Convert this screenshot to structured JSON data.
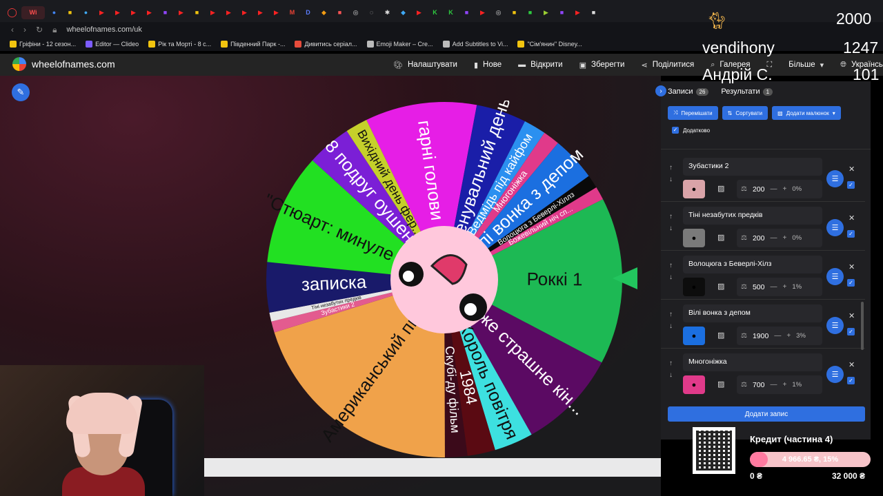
{
  "browser": {
    "active_tab_label": "Wi",
    "url": "wheelofnames.com/uk",
    "bookmarks": [
      {
        "label": "Грiфiни - 12 сезон...",
        "color": "#f1c40f"
      },
      {
        "label": "Editor — Clideo",
        "color": "#7c5cff"
      },
      {
        "label": "Рiк та Морті - 8 с...",
        "color": "#f1c40f"
      },
      {
        "label": "Південний Парк -...",
        "color": "#f1c40f"
      },
      {
        "label": "Дивитись серіал...",
        "color": "#e74c3c"
      },
      {
        "label": "Emoji Maker – Cre...",
        "color": "#bbbbbb"
      },
      {
        "label": "Add Subtitles to Vi...",
        "color": "#bbbbbb"
      },
      {
        "label": "\"Сім'янин\" Disney...",
        "color": "#f1c40f"
      }
    ]
  },
  "app": {
    "brand": "wheelofnames.com",
    "menu": [
      "Налаштувати",
      "Нове",
      "Відкрити",
      "Зберегти",
      "Поділитися",
      "Галерея",
      "",
      "Більше",
      "Українська"
    ]
  },
  "wheel": {
    "slices": [
      {
        "label": "Роккі 1",
        "color": "#1db954",
        "weight": 1
      },
      {
        "label": "Дуже страшне кін...",
        "color": "#5b0a63",
        "weight": 1
      },
      {
        "label": "Король повітря",
        "color": "#3de0e0",
        "weight": 1
      },
      {
        "label": "1984",
        "color": "#5a0a12",
        "weight": 1
      },
      {
        "label": "Скубі-ду фільм",
        "color": "#3b0a1a",
        "weight": 1
      },
      {
        "label": "Американський пир...",
        "color": "#f0a24a",
        "weight": 1
      },
      {
        "label": "Зубастики 2",
        "color": "#e35b8f",
        "weight": 1
      },
      {
        "label": "Тiнi незабутих предкiв",
        "color": "#e8e8e8",
        "weight": 1
      },
      {
        "label": "записка",
        "color": "#191a6a",
        "weight": 1
      },
      {
        "label": "\"Стюарт: минуле ж...",
        "color": "#22e022",
        "weight": 1
      },
      {
        "label": "8 подруг оушена",
        "color": "#7b1fd6",
        "weight": 1
      },
      {
        "label": "Вихідний день фер...",
        "color": "#c5d02b",
        "weight": 1
      },
      {
        "label": "гарні голови",
        "color": "#e61ee6",
        "weight": 1
      },
      {
        "label": "Тренувальний день",
        "color": "#1a1ea8",
        "weight": 1
      },
      {
        "label": "Ведмідь під кайфом",
        "color": "#2b90f0",
        "weight": 1
      },
      {
        "label": "Многоніжка",
        "color": "#e03a8a",
        "weight": 1
      },
      {
        "label": "Вiлi вонка з депом",
        "color": "#1b6fe0",
        "weight": 1
      },
      {
        "label": "Волоцюга з Беверлі-Хіллз",
        "color": "#0a0a0a",
        "weight": 1
      },
      {
        "label": "Божевільний ніч сп...",
        "color": "#e03a8a",
        "weight": 1
      }
    ]
  },
  "sidebar": {
    "tab_entries": "Записи",
    "entries_count": "26",
    "tab_results": "Результати",
    "results_count": "1",
    "shuffle": "Перемішати",
    "sort": "Сортувати",
    "add_image": "Додати малюнок",
    "advanced": "Додатково",
    "add_entry": "Додати запис",
    "entries": [
      {
        "name": "Зубастики 2",
        "weight": "200",
        "percent": "0%",
        "swatch": "#d9a3a8"
      },
      {
        "name": "Тiнi незабутих предкiв",
        "weight": "200",
        "percent": "0%",
        "swatch": "#7a7a7a"
      },
      {
        "name": "Волоцюга з Беверлі-Хілз",
        "weight": "500",
        "percent": "1%",
        "swatch": "#0d0d0d"
      },
      {
        "name": "Вiлi вонка з депом",
        "weight": "1900",
        "percent": "3%",
        "swatch": "#1b6fe0"
      },
      {
        "name": "Многоніжка",
        "weight": "700",
        "percent": "1%",
        "swatch": "#e03a8a"
      }
    ]
  },
  "stream": {
    "name": "vendihony",
    "sub_name": "Андрій С.",
    "stat_top": "2000",
    "stat_mid": "1247",
    "stat_bottom": "101",
    "credit_title": "Кредит (частина 4)",
    "credit_value": "4 966.65 ₴, 15%",
    "credit_progress": 0.15,
    "credit_min": "0 ₴",
    "credit_max": "32 000 ₴"
  }
}
